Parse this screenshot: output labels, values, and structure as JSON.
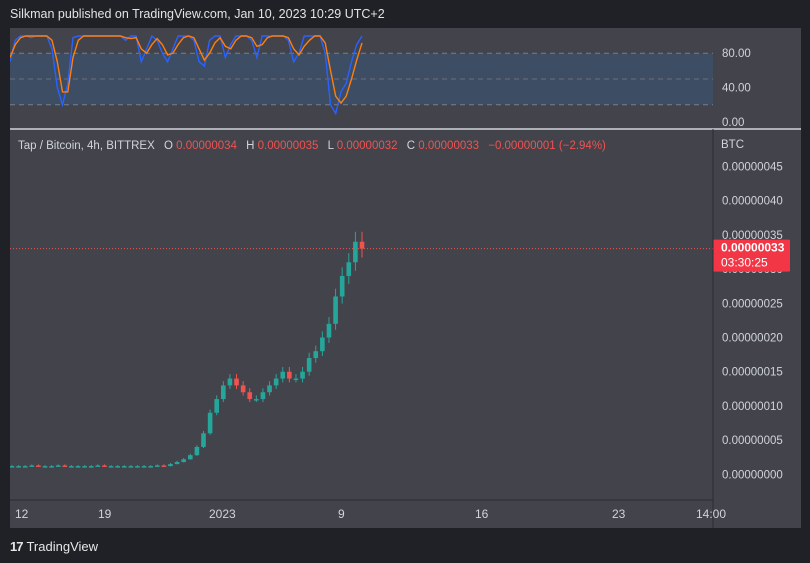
{
  "header": {
    "publish_line": "Silkman published on TradingView.com, Jan 10, 2023 10:29 UTC+2"
  },
  "legend": {
    "symbol": "Tap / Bitcoin, 4h, BITTREX",
    "o_label": "O",
    "o_value": "0.00000034",
    "h_label": "H",
    "h_value": "0.00000035",
    "l_label": "L",
    "l_value": "0.00000032",
    "c_label": "C",
    "c_value": "0.00000033",
    "change": "−0.00000001 (−2.94%)"
  },
  "price_axis": {
    "currency": "BTC",
    "last_price": "0.00000033",
    "countdown": "03:30:25"
  },
  "footer": {
    "logo_mark": "17",
    "brand": "TradingView"
  },
  "colors": {
    "background": "#1f2126",
    "pane": "#42434b",
    "up": "#26a69a",
    "down": "#ef5350",
    "osc_k": "#2962ff",
    "osc_d": "#ff7f0e",
    "band": "#3c4d64"
  },
  "chart_data": [
    {
      "type": "line",
      "role": "stochastic-rsi-oscillator",
      "ylim": [
        0,
        100
      ],
      "yticks": [
        "80.00",
        "40.00",
        "0.00"
      ],
      "band": [
        20,
        80
      ],
      "series": [
        {
          "color": "#2962ff",
          "values": [
            70,
            95,
            100,
            100,
            98,
            100,
            100,
            100,
            85,
            40,
            20,
            45,
            98,
            100,
            100,
            100,
            100,
            100,
            100,
            100,
            100,
            100,
            95,
            100,
            100,
            70,
            85,
            100,
            95,
            80,
            70,
            85,
            100,
            100,
            100,
            95,
            70,
            65,
            95,
            100,
            100,
            75,
            90,
            100,
            100,
            100,
            95,
            75,
            100,
            100,
            100,
            100,
            100,
            95,
            70,
            80,
            100,
            100,
            100,
            100,
            80,
            20,
            10,
            35,
            45,
            70,
            90,
            100
          ]
        },
        {
          "color": "#ff7f0e",
          "values": [
            75,
            90,
            98,
            100,
            100,
            100,
            100,
            100,
            95,
            70,
            35,
            35,
            75,
            95,
            100,
            100,
            100,
            100,
            100,
            100,
            100,
            100,
            98,
            97,
            98,
            85,
            80,
            90,
            97,
            90,
            78,
            80,
            90,
            98,
            100,
            98,
            85,
            72,
            80,
            92,
            98,
            88,
            85,
            95,
            100,
            100,
            98,
            88,
            90,
            98,
            100,
            100,
            100,
            98,
            85,
            78,
            88,
            95,
            100,
            100,
            92,
            60,
            30,
            22,
            30,
            50,
            72,
            92
          ]
        }
      ]
    },
    {
      "type": "candlestick",
      "title": "Tap / Bitcoin, 4h, BITTREX",
      "ylabel": "BTC",
      "ylim": [
        -2e-08,
        4.8e-07
      ],
      "yticks": [
        "0.00000045",
        "0.00000040",
        "0.00000035",
        "0.00000030",
        "0.00000025",
        "0.00000020",
        "0.00000015",
        "0.00000010",
        "0.00000005",
        "0.00000000"
      ],
      "xticks": [
        "12",
        "19",
        "2023",
        "9",
        "16",
        "23",
        "14:00"
      ],
      "close_series": [
        1.2e-08,
        1.2e-08,
        1.2e-08,
        1.3e-08,
        1.2e-08,
        1.2e-08,
        1.2e-08,
        1.3e-08,
        1.2e-08,
        1.2e-08,
        1.2e-08,
        1.2e-08,
        1.2e-08,
        1.3e-08,
        1.2e-08,
        1.2e-08,
        1.2e-08,
        1.2e-08,
        1.2e-08,
        1.2e-08,
        1.2e-08,
        1.2e-08,
        1.3e-08,
        1.2e-08,
        1.5e-08,
        1.8e-08,
        2.2e-08,
        2.8e-08,
        4e-08,
        6e-08,
        9e-08,
        1.1e-07,
        1.3e-07,
        1.4e-07,
        1.3e-07,
        1.2e-07,
        1.1e-07,
        1.1e-07,
        1.2e-07,
        1.3e-07,
        1.4e-07,
        1.5e-07,
        1.4e-07,
        1.4e-07,
        1.5e-07,
        1.7e-07,
        1.8e-07,
        2e-07,
        2.2e-07,
        2.6e-07,
        2.9e-07,
        3.1e-07,
        3.4e-07,
        3.3e-07
      ]
    }
  ]
}
